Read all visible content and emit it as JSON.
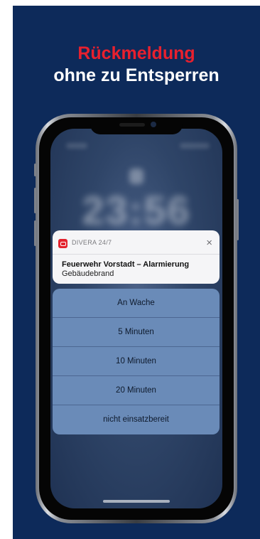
{
  "headline": {
    "line1": "Rückmeldung",
    "line2": "ohne zu Entsperren"
  },
  "lockscreen": {
    "time": "23:56"
  },
  "notification": {
    "app_name": "DIVERA 24/7",
    "title": "Feuerwehr Vorstadt – Alarmierung",
    "body": "Gebäudebrand",
    "close_symbol": "×",
    "app_icon": "divera-app-icon"
  },
  "actions": [
    {
      "label": "An Wache"
    },
    {
      "label": "5 Minuten"
    },
    {
      "label": "10 Minuten"
    },
    {
      "label": "20 Minuten"
    },
    {
      "label": "nicht einsatzbereit"
    }
  ],
  "colors": {
    "background": "#0d2a5a",
    "accent_red": "#e8202e",
    "action_panel": "#6a8bb8",
    "notification_bg": "#f5f5f7"
  }
}
